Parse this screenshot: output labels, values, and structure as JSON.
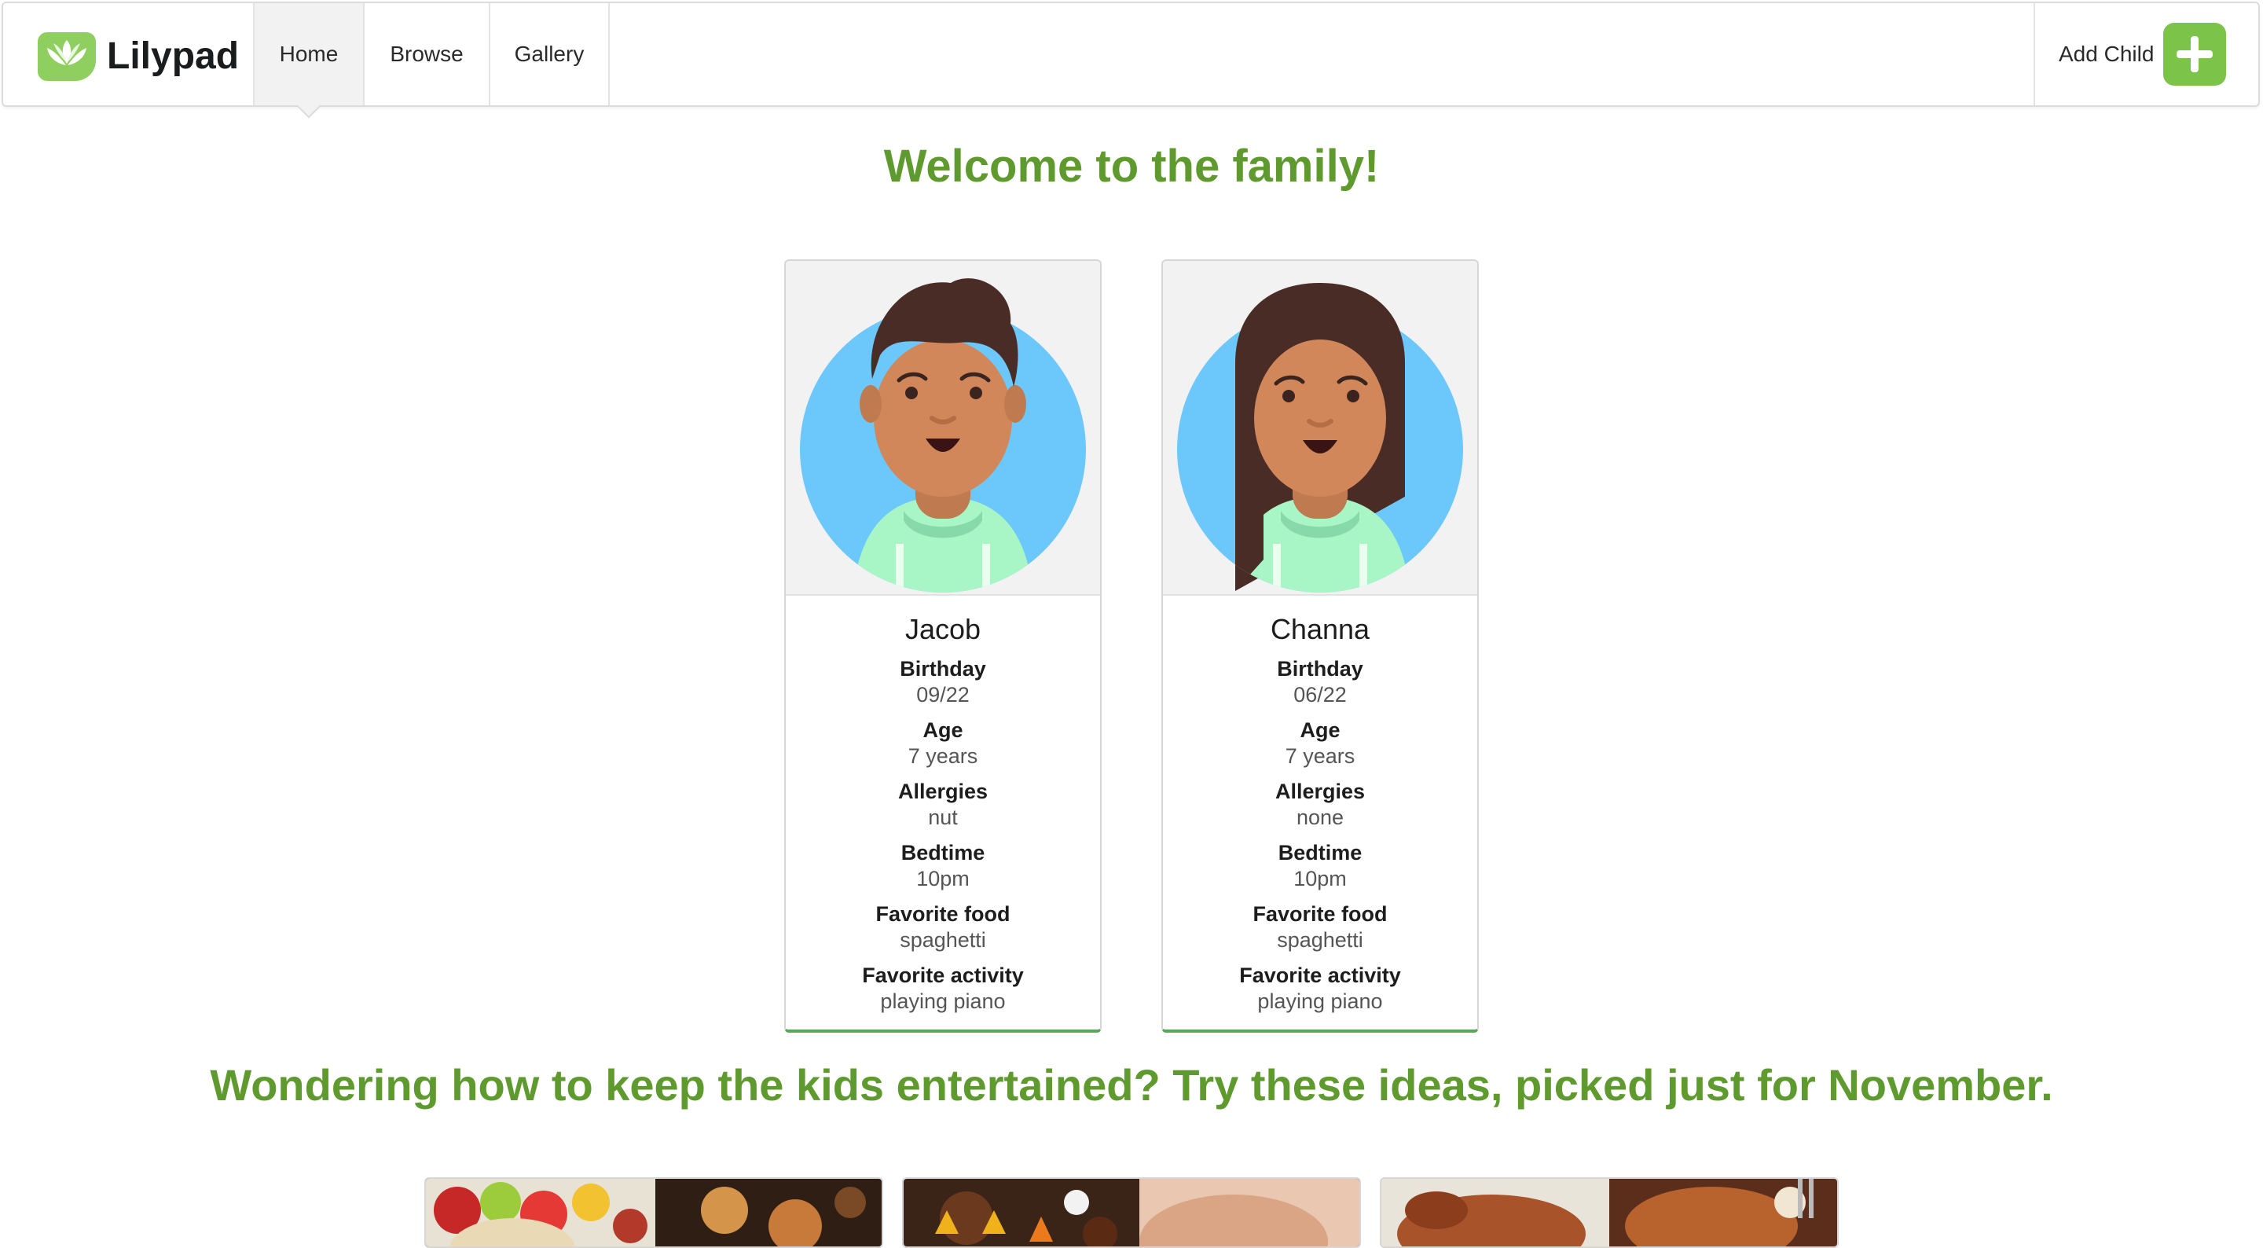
{
  "nav": {
    "brand": "Lilypad",
    "logo_icon": "lotus-icon",
    "items": [
      {
        "label": "Home",
        "active": true
      },
      {
        "label": "Browse",
        "active": false
      },
      {
        "label": "Gallery",
        "active": false
      }
    ],
    "add_child_label": "Add Child",
    "add_child_icon": "plus-icon"
  },
  "welcome": "Welcome to the family!",
  "children": [
    {
      "name": "Jacob",
      "avatar_icon": "boy-avatar-icon",
      "fields": [
        {
          "label": "Birthday",
          "value": "09/22"
        },
        {
          "label": "Age",
          "value": "7 years"
        },
        {
          "label": "Allergies",
          "value": "nut"
        },
        {
          "label": "Bedtime",
          "value": "10pm"
        },
        {
          "label": "Favorite food",
          "value": "spaghetti"
        },
        {
          "label": "Favorite activity",
          "value": "playing piano"
        }
      ]
    },
    {
      "name": "Channa",
      "avatar_icon": "girl-avatar-icon",
      "fields": [
        {
          "label": "Birthday",
          "value": "06/22"
        },
        {
          "label": "Age",
          "value": "7 years"
        },
        {
          "label": "Allergies",
          "value": "none"
        },
        {
          "label": "Bedtime",
          "value": "10pm"
        },
        {
          "label": "Favorite food",
          "value": "spaghetti"
        },
        {
          "label": "Favorite activity",
          "value": "playing piano"
        }
      ]
    }
  ],
  "ideas_heading": "Wondering how to keep the kids entertained? Try these ideas, picked just for November.",
  "colors": {
    "brand_green": "#5f9a2e",
    "accent_green": "#7cc349",
    "avatar_bg": "#6cc8fb",
    "skin": "#d1875a",
    "hair": "#4a2c26",
    "hoodie": "#a8f5c6"
  }
}
